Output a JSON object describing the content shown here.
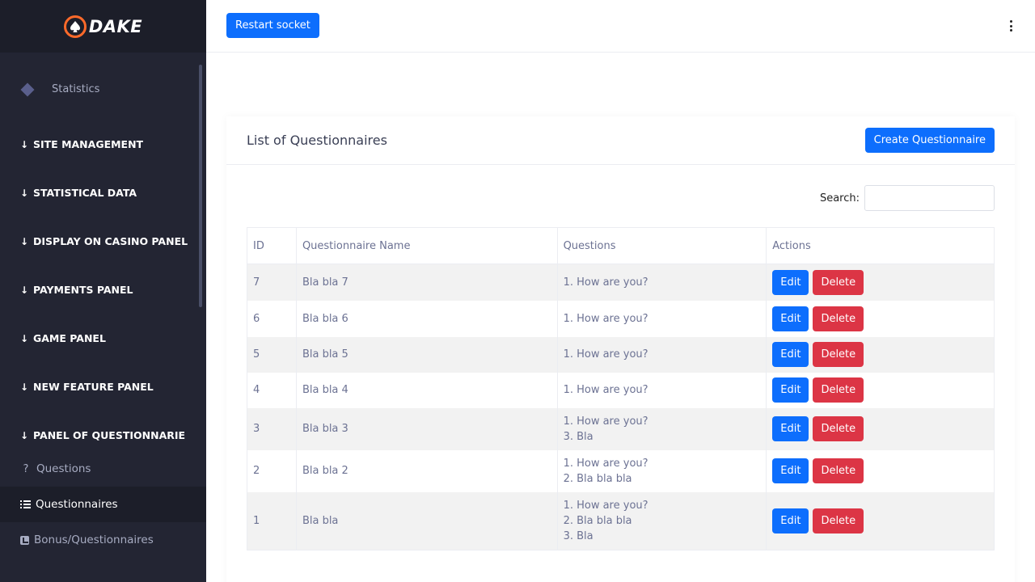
{
  "brand": {
    "name": "DAKE"
  },
  "sidebar": {
    "statistics": "Statistics",
    "sections": [
      "SITE MANAGEMENT",
      "STATISTICAL DATA",
      "DISPLAY ON CASINO PANEL",
      "PAYMENTS PANEL",
      "GAME PANEL",
      "NEW FEATURE PANEL",
      "PANEL OF QUESTIONNARIE"
    ],
    "sub_items": [
      {
        "label": "Questions",
        "icon": "question-icon"
      },
      {
        "label": "Questionnaires",
        "icon": "list-icon",
        "active": true
      },
      {
        "label": "Bonus/Questionnaires",
        "icon": "chart-icon"
      }
    ]
  },
  "topbar": {
    "restart_label": "Restart socket"
  },
  "card": {
    "title": "List of Questionnaires",
    "create_label": "Create Questionnaire",
    "search_label": "Search:",
    "search_value": ""
  },
  "table": {
    "headers": [
      "ID",
      "Questionnaire Name",
      "Questions",
      "Actions"
    ],
    "rows": [
      {
        "id": "7",
        "name": "Bla bla 7",
        "questions": [
          "1. How are you?"
        ]
      },
      {
        "id": "6",
        "name": "Bla bla 6",
        "questions": [
          "1. How are you?"
        ]
      },
      {
        "id": "5",
        "name": "Bla bla 5",
        "questions": [
          "1. How are you?"
        ]
      },
      {
        "id": "4",
        "name": "Bla bla 4",
        "questions": [
          "1. How are you?"
        ]
      },
      {
        "id": "3",
        "name": "Bla bla 3",
        "questions": [
          "1. How are you?",
          "3. Bla"
        ]
      },
      {
        "id": "2",
        "name": "Bla bla 2",
        "questions": [
          "1. How are you?",
          "2. Bla bla bla"
        ]
      },
      {
        "id": "1",
        "name": "Bla bla",
        "questions": [
          "1. How are you?",
          "2. Bla bla bla",
          "3. Bla"
        ]
      }
    ],
    "edit_label": "Edit",
    "delete_label": "Delete"
  },
  "colors": {
    "primary": "#0d6efd",
    "danger": "#dc3545",
    "sidebar": "#232533",
    "brand_accent": "#ff6a2a"
  }
}
